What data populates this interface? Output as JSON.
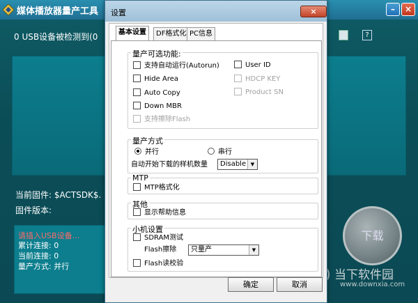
{
  "app": {
    "title": "媒体播放器量产工具",
    "minimize": "–",
    "close": "×",
    "usb_status": "0 USB设备被检测到(0",
    "help": "?",
    "firmware_current": "当前固件: $ACTSDK$.",
    "firmware_version": "固件版本:",
    "status": {
      "insert": "请插入USB设备...",
      "total": "累计连接:  0",
      "current": "当前连接:  0",
      "mode": "量产方式: 并行"
    },
    "download": "下载"
  },
  "watermark": {
    "name": "当下软件园",
    "url": "www.downxia.com"
  },
  "dialog": {
    "title": "设置",
    "close": "×",
    "tabs": [
      "基本设置",
      "DF格式化",
      "PC信息"
    ],
    "groups": {
      "optional": {
        "title": "量产可选功能:",
        "items": [
          {
            "label": "支持自动运行(Autorun)",
            "enabled": true
          },
          {
            "label": "Hide Area",
            "enabled": true
          },
          {
            "label": "Auto Copy",
            "enabled": true
          },
          {
            "label": "Down MBR",
            "enabled": true
          },
          {
            "label": "支持擦除Flash",
            "enabled": false
          },
          {
            "label": "User ID",
            "enabled": true
          },
          {
            "label": "HDCP KEY",
            "enabled": false
          },
          {
            "label": "Product SN",
            "enabled": false
          }
        ]
      },
      "mode": {
        "title": "量产方式",
        "parallel": "并行",
        "serial": "串行",
        "auto_start": "自动开始下载的样机数量",
        "auto_start_value": "Disable"
      },
      "mtp": {
        "title": "MTP",
        "format": "MTP格式化"
      },
      "other": {
        "title": "其他",
        "show_help": "显示帮助信息"
      },
      "small": {
        "title": "小机设置",
        "sdram": "SDRAM测试",
        "flash_erase_label": "Flash擦除",
        "flash_erase_value": "只量产",
        "flash_verify": "Flash读校验"
      }
    },
    "ok": "确定",
    "cancel": "取消"
  }
}
